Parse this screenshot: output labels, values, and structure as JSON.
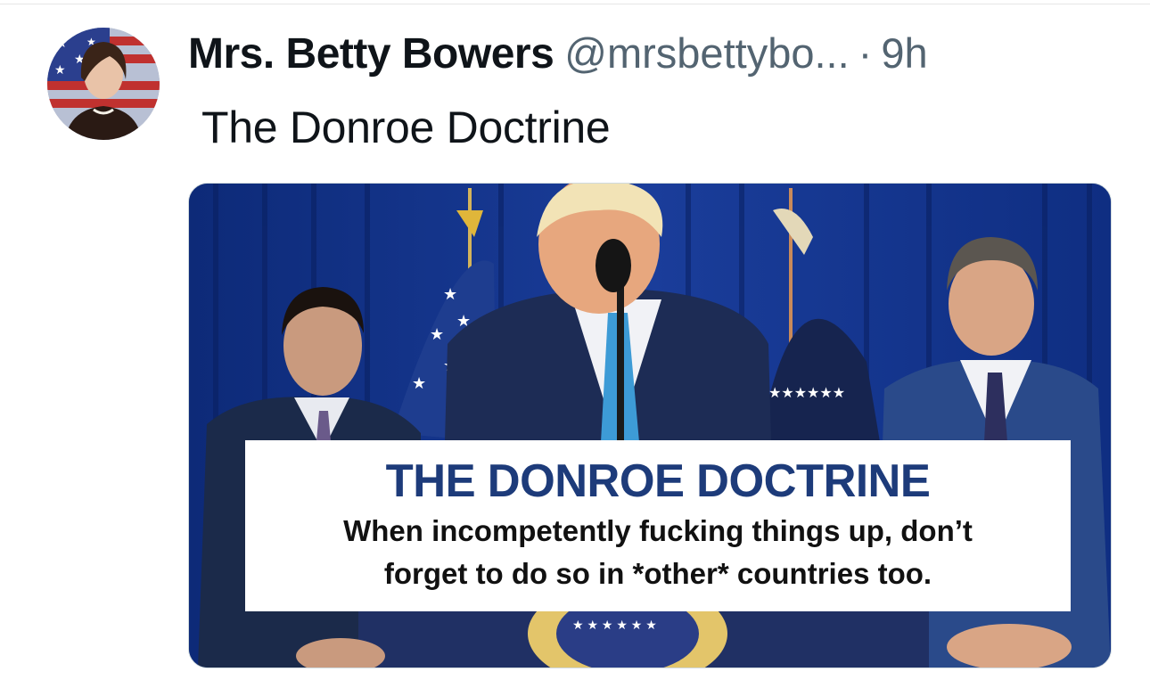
{
  "tweet": {
    "author_name": "Mrs. Betty Bowers",
    "handle": "@mrsbettybo...",
    "separator": "·",
    "timestamp": "9h",
    "text": "The Donroe Doctrine"
  },
  "media": {
    "caption_title": "THE DONROE DOCTRINE",
    "caption_line1": "When incompetently fucking things up, don’t",
    "caption_line2": "forget to do so in *other* countries too."
  },
  "colors": {
    "curtain": "#16358a",
    "caption_title": "#1d3b7a",
    "handle_gray": "#536471"
  }
}
